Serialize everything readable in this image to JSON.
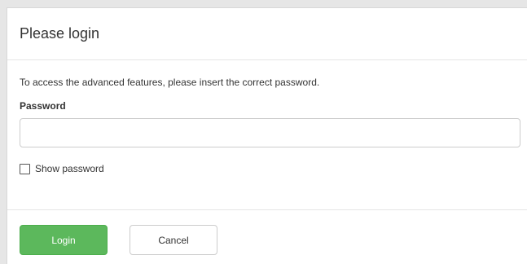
{
  "dialog": {
    "title": "Please login",
    "intro": "To access the advanced features, please insert the correct password.",
    "password_label": "Password",
    "password_value": "",
    "password_placeholder": "",
    "show_password_label": "Show password",
    "show_password_checked": false,
    "login_label": "Login",
    "cancel_label": "Cancel"
  },
  "colors": {
    "login_button": "#5cb85c",
    "background": "#e6e6e6"
  }
}
